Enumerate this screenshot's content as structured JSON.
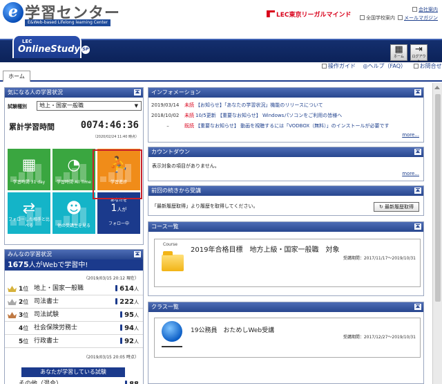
{
  "header": {
    "logo_title": "学習センター",
    "logo_sub": "E&Web-based Lifelong learning Center",
    "lec_brand": "レL̲EC東京リーガルマインド",
    "link_company": "会社案内",
    "link_school": "全国学校案内",
    "link_magazine": "メールマガジン"
  },
  "band": {
    "brand_small": "LEC",
    "brand_main": "OnlineStudy",
    "brand_badge": "SP",
    "home_label": "ホーム",
    "logout_label": "ログアウト"
  },
  "tabs": {
    "home": "ホーム"
  },
  "help_links": {
    "guide": "操作ガイド",
    "help": "ヘルプ（FAQ）",
    "contact": "お問合せ"
  },
  "study": {
    "header": "気になる人の学習状況",
    "type_label": "試験種別",
    "type_value": "地上・国家一般職",
    "total_label": "累計学習時間",
    "total_time": "0074:46:36",
    "total_date": "（2020/02/24 11:40 時点）",
    "tiles": {
      "t1": "学習時間 31 day",
      "t2": "学習時間 All Time",
      "t3": "学習進捗",
      "t4": "フォローした相手と比べる",
      "t5": "他の受講生を見る"
    },
    "follow": {
      "line1": "あなたを",
      "count": "1",
      "unit": "人が",
      "line3": "フォロー中"
    }
  },
  "ranking": {
    "header": "みんなの学習状況",
    "count": "1675",
    "count_suffix": "人がWebで学習中!",
    "date_top": "（2019/03/15 20:12 現在）",
    "rows": [
      {
        "pos": "1",
        "unit": "位",
        "name": "地上・国家一般職",
        "count": "614",
        "cunit": "人"
      },
      {
        "pos": "2",
        "unit": "位",
        "name": "司法書士",
        "count": "222",
        "cunit": "人"
      },
      {
        "pos": "3",
        "unit": "位",
        "name": "司法試験",
        "count": "95",
        "cunit": "人"
      },
      {
        "pos": "4",
        "unit": "位",
        "name": "社会保険労務士",
        "count": "94",
        "cunit": "人"
      },
      {
        "pos": "5",
        "unit": "位",
        "name": "行政書士",
        "count": "92",
        "cunit": "人"
      }
    ],
    "date_bottom": "（2019/03/15 20:05 時点）",
    "button": "あなたが学習している試験",
    "other_label": "その他（混合）",
    "other_count": "88"
  },
  "info": {
    "header": "インフォメーション",
    "items": [
      {
        "date": "2019/03/14",
        "tag": "未読",
        "text": "【お知らせ】「あなたの学習状況」機能のリリースについて"
      },
      {
        "date": "2018/10/02",
        "tag": "未読",
        "text": "10/5更新 【重要なお知らせ】 Windowsパソコンをご利用の皆様へ"
      },
      {
        "date": "–",
        "tag": "既読",
        "text": "【重要なお知らせ】 動画を視聴するには「VODBOX（無料）」のインストールが必要です"
      }
    ],
    "more": "more..."
  },
  "countdown": {
    "header": "カウントダウン",
    "text": "表示対象の項目がありません。",
    "more": "more..."
  },
  "resume": {
    "header": "前回の続きから受講",
    "text": "「最新履歴取得」より履歴を取得してください。",
    "button": "最新履歴取得"
  },
  "courses": {
    "header": "コース一覧",
    "label": "Course",
    "title": "2019年合格目標　地方上級・国家一般職　対象",
    "period": "受講期間：2017/11/17～2019/10/31"
  },
  "classes": {
    "header": "クラス一覧",
    "title": "19公務員　おためしWeb受講",
    "period": "受講期間：2017/12/27～2019/10/31"
  },
  "colors": {
    "navy": "#1b3a8c",
    "green": "#3aa640",
    "orange": "#f08c19",
    "cyan": "#14b4c8",
    "red": "#d9001b"
  }
}
